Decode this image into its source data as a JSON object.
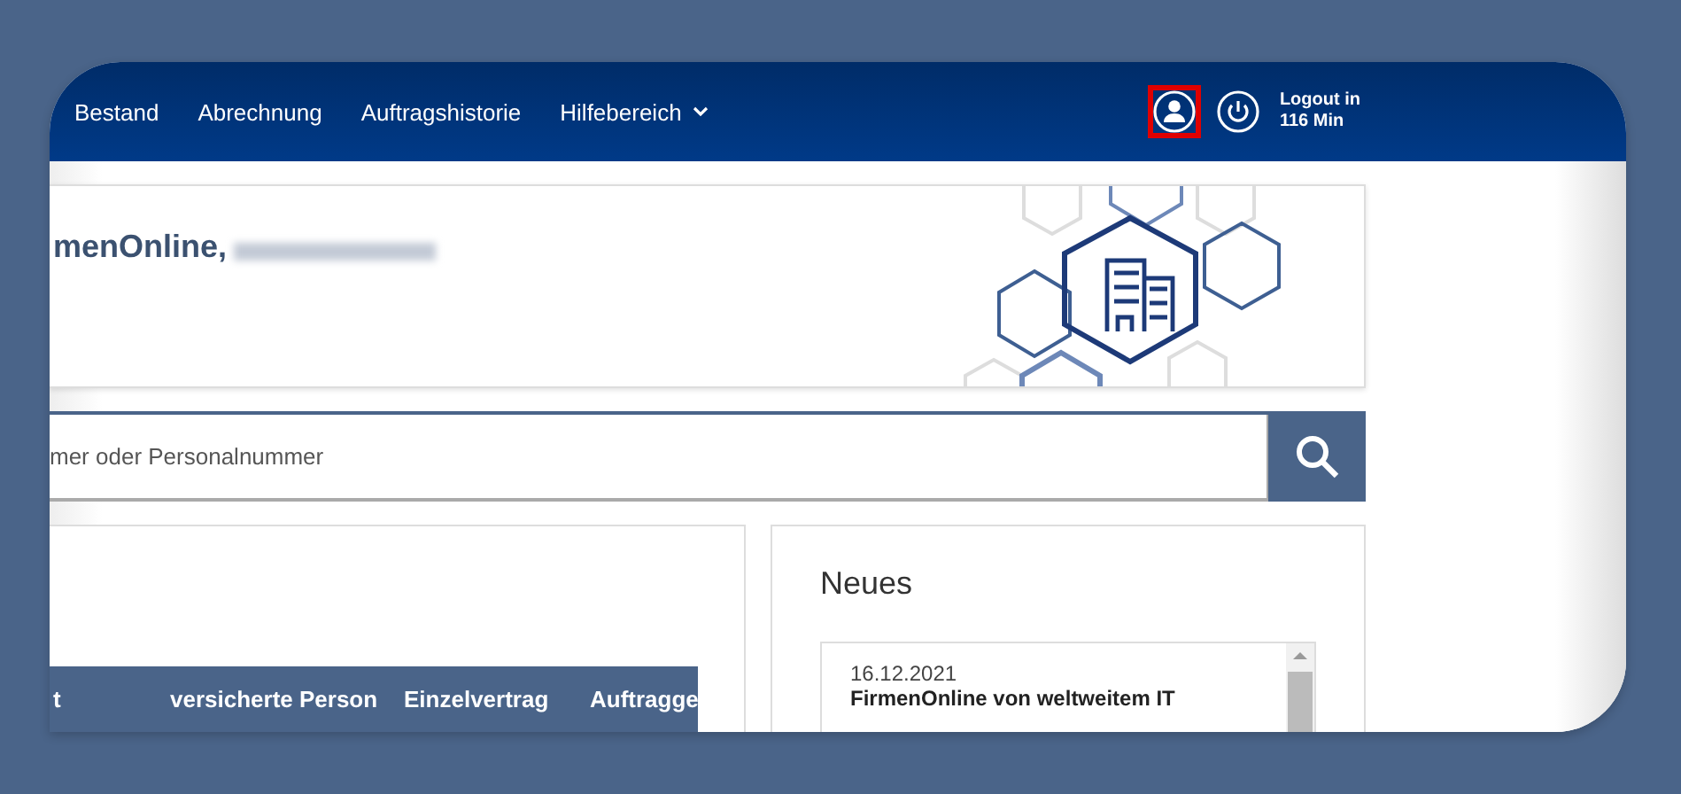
{
  "nav": {
    "items": [
      {
        "label": "Bestand",
        "kind": "link"
      },
      {
        "label": "Abrechnung",
        "kind": "link"
      },
      {
        "label": "Auftragshistorie",
        "kind": "link"
      },
      {
        "label": "Hilfebereich",
        "kind": "dropdown"
      }
    ],
    "account_button": {
      "highlighted": true
    },
    "logout": {
      "line_1": "Logout in",
      "line_2": "116 Min"
    }
  },
  "banner": {
    "title": "menOnline,"
  },
  "search": {
    "placeholder": "mer oder Personalnummer"
  },
  "table": {
    "columns": [
      "t",
      "versicherte Person",
      "Einzelvertrag",
      "Auftragge"
    ]
  },
  "news": {
    "title": "Neues",
    "items": [
      {
        "date": "16.12.2021",
        "headline": "FirmenOnline von weltweitem IT"
      }
    ]
  }
}
